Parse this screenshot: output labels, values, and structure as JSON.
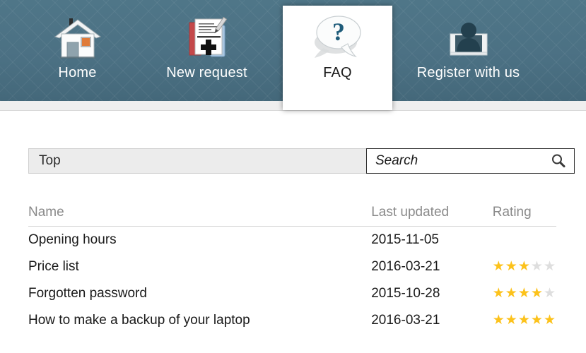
{
  "nav": {
    "items": [
      {
        "label": "Home",
        "icon": "house-icon",
        "active": false
      },
      {
        "label": "New request",
        "icon": "new-document-icon",
        "active": false
      },
      {
        "label": "FAQ",
        "icon": "question-bubble-icon",
        "active": true
      },
      {
        "label": "Register with us",
        "icon": "person-icon",
        "active": false
      }
    ]
  },
  "toolbar": {
    "breadcrumb": "Top",
    "search_value": "",
    "search_placeholder": "Search",
    "search_icon": "magnifier-icon"
  },
  "table": {
    "headers": {
      "name": "Name",
      "last_updated": "Last updated",
      "rating": "Rating"
    },
    "rows": [
      {
        "name": "Opening hours",
        "last_updated": "2015-11-05",
        "rating": 0
      },
      {
        "name": "Price list",
        "last_updated": "2016-03-21",
        "rating": 3
      },
      {
        "name": "Forgotten password",
        "last_updated": "2015-10-28",
        "rating": 4
      },
      {
        "name": "How to make a backup of your laptop",
        "last_updated": "2016-03-21",
        "rating": 5
      }
    ],
    "rating_max": 5
  },
  "colors": {
    "nav_background": "#4c7184",
    "strip": "#efefef",
    "breadcrumb_background": "#ececec",
    "star_filled": "#fcc21b",
    "star_empty": "#dedede",
    "header_text": "#8a8a8a"
  }
}
